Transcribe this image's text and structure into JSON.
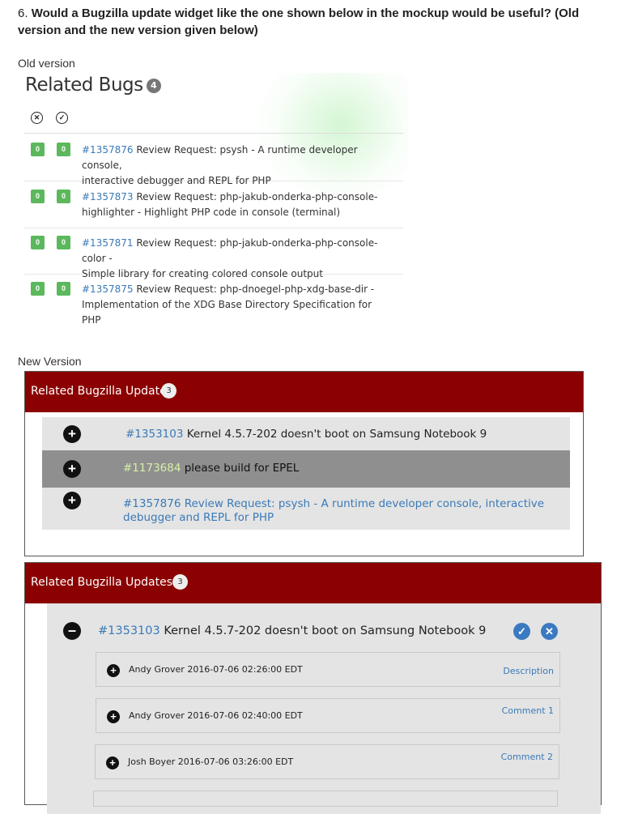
{
  "question": {
    "number": "6.",
    "text": "Would a Bugzilla update widget like the one shown below in the mockup would be useful? (Old version and the new version given below)"
  },
  "old_version": {
    "label": "Old version",
    "title": "Related Bugs",
    "count": "4",
    "header_icons": [
      "x-circle-icon",
      "check-circle-icon"
    ],
    "rows": [
      {
        "badge1": "0",
        "badge2": "0",
        "id": "#1357876",
        "line1": "Review Request: psysh - A runtime developer console,",
        "line2": "interactive debugger and REPL for PHP"
      },
      {
        "badge1": "0",
        "badge2": "0",
        "id": "#1357873",
        "line1": "Review Request: php-jakub-onderka-php-console-",
        "line2": "highlighter - Highlight PHP code in console (terminal)"
      },
      {
        "badge1": "0",
        "badge2": "0",
        "id": "#1357871",
        "line1": "Review Request: php-jakub-onderka-php-console-color -",
        "line2": "Simple library for creating colored console output"
      },
      {
        "badge1": "0",
        "badge2": "0",
        "id": "#1357875",
        "line1": "Review Request: php-dnoegel-php-xdg-base-dir -",
        "line2": "Implementation of the XDG Base Directory Specification for PHP"
      }
    ],
    "colors": {
      "badge": "#5cb85c",
      "link": "#3a7ab8"
    }
  },
  "new_version": {
    "label": "New Version",
    "panel1": {
      "title": "Related Bugzilla Updates",
      "count": "3",
      "rows": [
        {
          "id": "#1353103",
          "text": "Kernel 4.5.7-202 doesn't boot on Samsung Notebook 9"
        },
        {
          "id": "#1173684",
          "text": "please build for EPEL"
        },
        {
          "line1": "#1357876 Review Request: psysh - A runtime developer console, interactive",
          "line2": "debugger and REPL for PHP"
        }
      ]
    },
    "panel2": {
      "title": "Related Bugzilla Updates",
      "count": "3",
      "main": {
        "id": "#1353103",
        "text": "Kernel 4.5.7-202 doesn't boot on Samsung Notebook 9"
      },
      "subs": [
        {
          "text": "Andy Grover 2016-07-06 02:26:00 EDT",
          "link": "Description"
        },
        {
          "text": "Andy Grover 2016-07-06 02:40:00 EDT",
          "link": "Comment 1"
        },
        {
          "text": "Josh Boyer 2016-07-06 03:26:00 EDT",
          "link": "Comment 2"
        }
      ]
    },
    "colors": {
      "header": "#8b0000",
      "link": "#3a7ab8",
      "highlight_row": "#8f8f8f"
    }
  }
}
